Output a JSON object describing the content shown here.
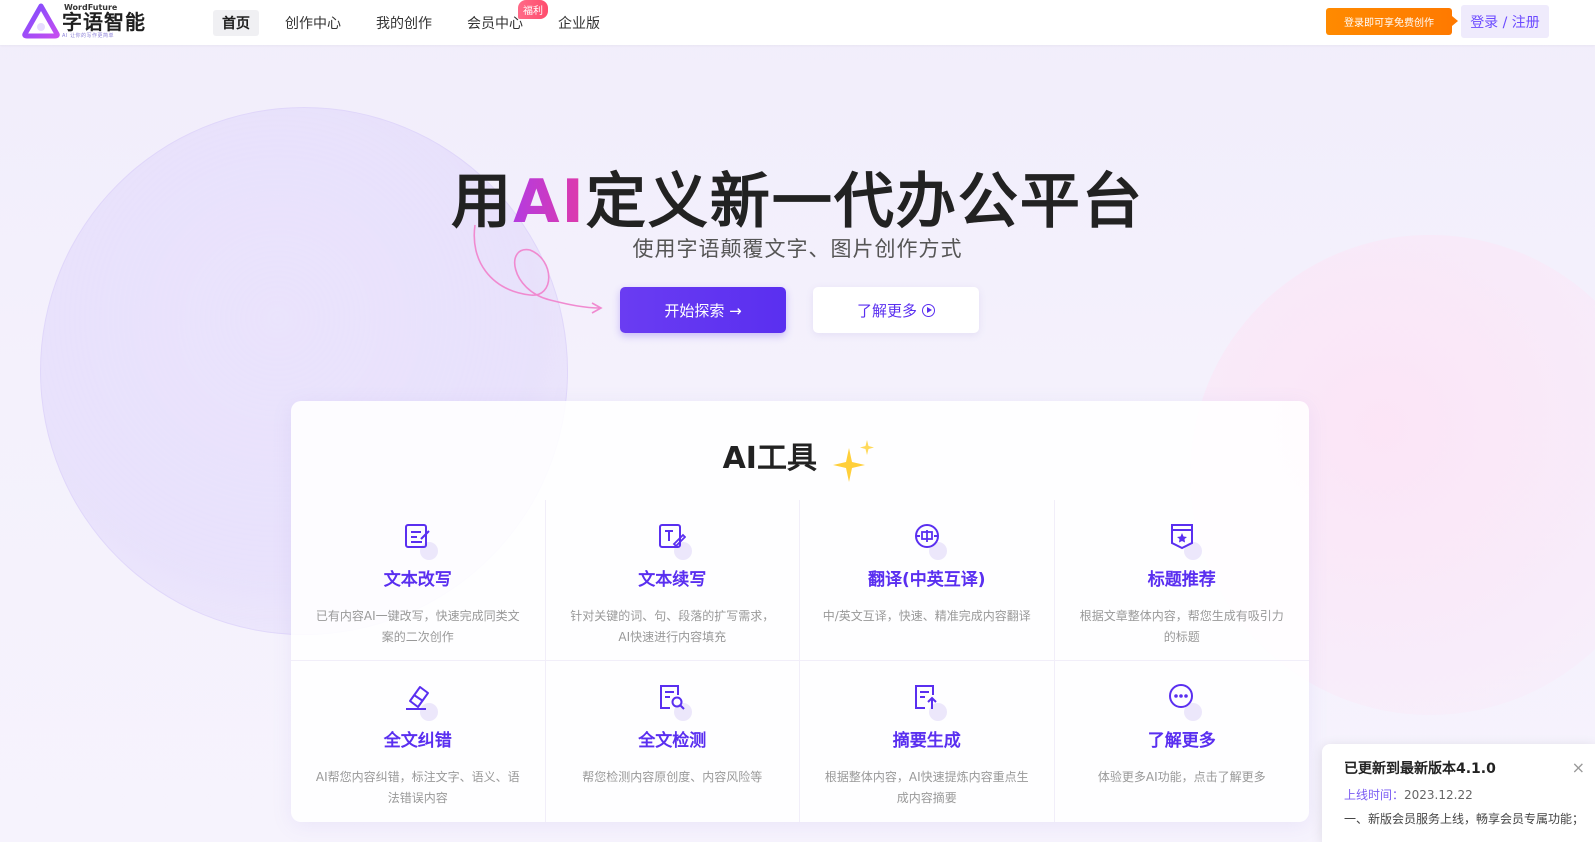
{
  "header": {
    "logo_en": "WordFuture",
    "logo_cn": "字语智能",
    "logo_sub": "AI 让你的写作更简单",
    "nav": [
      {
        "label": "首页",
        "active": true
      },
      {
        "label": "创作中心",
        "active": false
      },
      {
        "label": "我的创作",
        "active": false
      },
      {
        "label": "会员中心",
        "active": false
      },
      {
        "label": "企业版",
        "active": false
      }
    ],
    "member_badge": "福利",
    "promo_label": "登录即可享免费创作",
    "login_label": "登录 / 注册"
  },
  "hero": {
    "title_prefix": "用",
    "title_ai": "AI",
    "title_suffix": "定义新一代办公平台",
    "subtitle": "使用字语颠覆文字、图片创作方式",
    "start_label": "开始探索 →",
    "more_label": "了解更多"
  },
  "tools": {
    "title": "AI工具",
    "items": [
      {
        "name": "文本改写",
        "desc": "已有内容AI一键改写，快速完成同类文案的二次创作",
        "icon": "edit-doc-icon"
      },
      {
        "name": "文本续写",
        "desc": "针对关键的词、句、段落的扩写需求，AI快速进行内容填充",
        "icon": "pen-text-icon"
      },
      {
        "name": "翻译(中英互译)",
        "desc": "中/英文互译，快速、精准完成内容翻译",
        "icon": "translate-icon"
      },
      {
        "name": "标题推荐",
        "desc": "根据文章整体内容，帮您生成有吸引力的标题",
        "icon": "star-badge-icon"
      },
      {
        "name": "全文纠错",
        "desc": "AI帮您内容纠错，标注文字、语义、语法错误内容",
        "icon": "eraser-icon"
      },
      {
        "name": "全文检测",
        "desc": "帮您检测内容原创度、内容风险等",
        "icon": "doc-search-icon"
      },
      {
        "name": "摘要生成",
        "desc": "根据整体内容，AI快速提炼内容重点生成内容摘要",
        "icon": "doc-upload-icon"
      },
      {
        "name": "了解更多",
        "desc": "体验更多AI功能，点击了解更多",
        "icon": "more-dots-icon"
      }
    ]
  },
  "notice": {
    "title": "已更新到最新版本4.1.0",
    "time_label": "上线时间：",
    "time_value": "2023.12.22",
    "body": "一、新版会员服务上线，畅享会员专属功能；",
    "close": "×"
  },
  "colors": {
    "accent": "#5a2ff0",
    "promo": "#ff7a00",
    "ai_gradient_start": "#b43be0",
    "ai_gradient_end": "#e03aa8"
  }
}
